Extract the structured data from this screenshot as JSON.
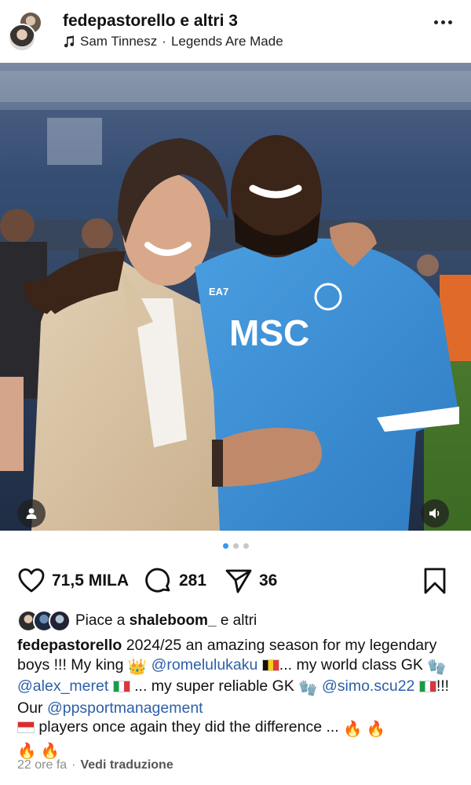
{
  "header": {
    "username": "fedepastorello",
    "coauthors": "e altri 3",
    "music_artist": "Sam Tinnesz",
    "music_separator": "·",
    "music_track": "Legends Are Made",
    "more_icon": "more-horizontal-icon"
  },
  "photo": {
    "jersey_sponsor": "MSC",
    "jersey_brand": "EA7",
    "user_tag_icon": "person-icon",
    "sound_icon": "volume-muted-icon"
  },
  "carousel": {
    "total": 3,
    "active": 1
  },
  "actions": {
    "likes_count": "71,5 MILA",
    "comments_count": "281",
    "shares_count": "36",
    "like_icon": "heart-icon",
    "comment_icon": "comment-icon",
    "share_icon": "send-icon",
    "save_icon": "bookmark-icon"
  },
  "liked_by": {
    "prefix": "Piace a",
    "user": "shaleboom_",
    "suffix": "e altri"
  },
  "caption": {
    "username": "fedepastorello",
    "part1": "2024/25 an amazing season for my legendary boys !!! My king ",
    "emoji_crown": "👑",
    "mention1": "@romelulukaku",
    "flag1": "belgium",
    "part2": "... my world class GK ",
    "emoji_glove1": "🧤",
    "mention2": "@alex_meret",
    "flag2": "italy",
    "part3": " ... my super reliable GK ",
    "emoji_glove2": "🧤",
    "mention3": "@simo.scu22",
    "flag3": "italy",
    "part4": "!!! Our ",
    "mention4": "@ppsportmanagement",
    "flag4": "indonesia",
    "part5": " players once again they did the difference ... ",
    "emoji_fire": "🔥"
  },
  "meta": {
    "time": "22 ore fa",
    "separator": "·",
    "translate": "Vedi traduzione"
  },
  "colors": {
    "accent": "#3897f0",
    "mention": "#2d5fa8",
    "jersey": "#3d8ed6"
  }
}
